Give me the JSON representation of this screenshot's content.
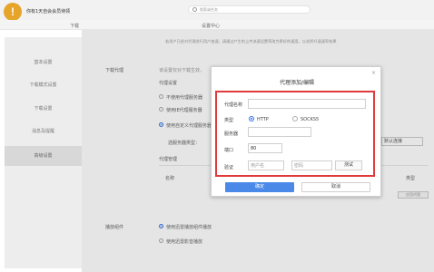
{
  "topbar": {
    "notice": "你有1天自会会员待领",
    "search_placeholder": "搜索或任务"
  },
  "tabs": [
    "下载",
    "设置中心"
  ],
  "sidebar": {
    "items": [
      "基本设置",
      "下载模式设置",
      "下载设置",
      "消息及提醒",
      "高级设置"
    ],
    "active_index": 4
  },
  "main": {
    "notice": "若用户已经对代理进行用户加速，请通过产生的上传流速设置率改为更好的速度，以发挥升速速率效果",
    "download_proxy_label": "下载代理",
    "proxy_desc": "该设置仅对下载生效，",
    "proxy_settings_title": "代理设置",
    "options": [
      "不使用代理服务器",
      "使用IE代理服务器",
      "使用自定义代理服务器"
    ],
    "server_type_label": "选服务器类型：",
    "right_select": "默认连接",
    "proxy_manage_title": "代理管理",
    "col_name": "名称",
    "col_type": "类型",
    "apply_button": "应用代理",
    "playback_label": "播放组件",
    "playback_options": [
      "使用迅雷播放组件播放",
      "使用迅雷影音播放"
    ]
  },
  "dialog": {
    "title": "代理添加/编辑",
    "name_label": "代理名称",
    "type_label": "类型",
    "type_options": [
      "HTTP",
      "SOCKS5"
    ],
    "server_label": "服务器",
    "port_label": "端口",
    "port_value": "80",
    "auth_label": "验证",
    "username_placeholder": "用户名",
    "password_placeholder": "密码",
    "test_button": "测试",
    "confirm_button": "确定",
    "cancel_button": "取消",
    "close_glyph": "×"
  }
}
